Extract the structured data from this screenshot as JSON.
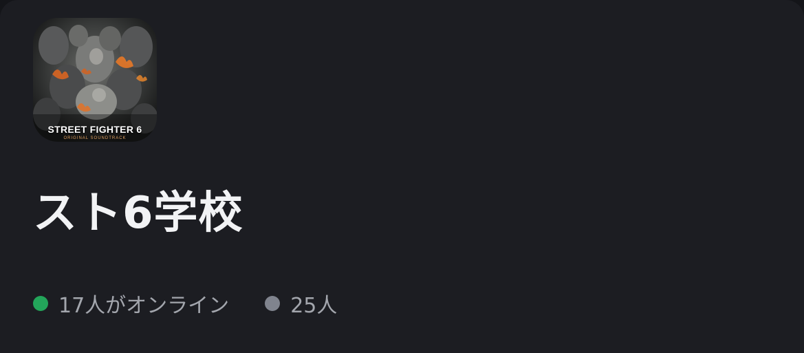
{
  "colors": {
    "background": "#1c1d22",
    "title": "#f2f3f5",
    "meta_text": "#a3a6ad",
    "online_dot": "#23a55a",
    "member_dot": "#80848e"
  },
  "server": {
    "icon": {
      "name": "server-icon",
      "logo_text": "STREET FIGHTER 6",
      "logo_subtext": "ORIGINAL SOUNDTRACK"
    },
    "name": "スト6学校"
  },
  "stats": {
    "online_label": "17人がオンライン",
    "members_label": "25人"
  }
}
